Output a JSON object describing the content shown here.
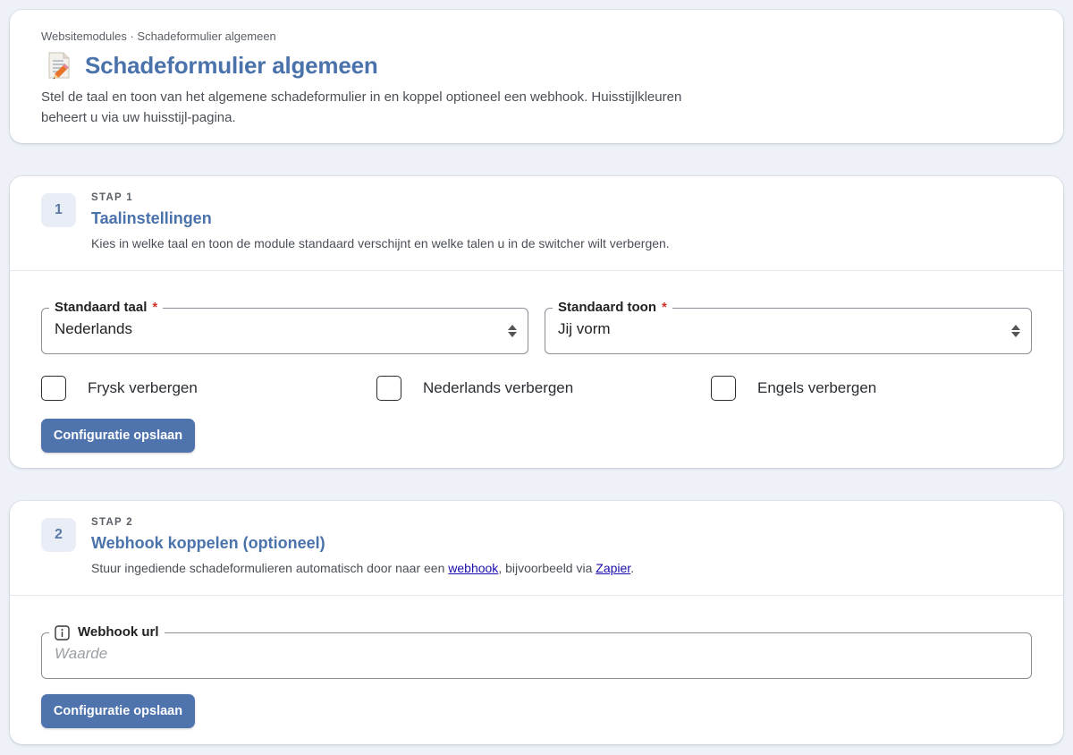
{
  "header": {
    "breadcrumb": "Websitemodules · Schadeformulier algemeen",
    "title": "Schadeformulier algemeen",
    "title_icon": "memo-pencil-icon",
    "description": "Stel de taal en toon van het algemene schadeformulier in en koppel optioneel een webhook. Huisstijlkleuren beheert u via uw huisstijl-pagina."
  },
  "step1": {
    "number": "1",
    "kicker": "STAP 1",
    "title": "Taalinstellingen",
    "description": "Kies in welke taal en toon de module standaard verschijnt en welke talen u in de switcher wilt verbergen.",
    "language_field": {
      "label": "Standaard taal",
      "required_mark": "*",
      "value": "Nederlands"
    },
    "tone_field": {
      "label": "Standaard toon",
      "required_mark": "*",
      "value": "Jij vorm"
    },
    "checkboxes": [
      {
        "label": "Frysk verbergen",
        "checked": false
      },
      {
        "label": "Nederlands verbergen",
        "checked": false
      },
      {
        "label": "Engels verbergen",
        "checked": false
      }
    ],
    "save_label": "Configuratie opslaan"
  },
  "step2": {
    "number": "2",
    "kicker": "STAP 2",
    "title": "Webhook koppelen (optioneel)",
    "description_before": "Stuur ingediende schadeformulieren automatisch door naar een ",
    "link_webhook": "webhook",
    "description_middle": ", bijvoorbeeld via ",
    "link_zapier": "Zapier",
    "description_after": ".",
    "webhook_field": {
      "label": "Webhook url",
      "value": "",
      "placeholder": "Waarde",
      "icon": "info-icon"
    },
    "save_label": "Configuratie opslaan"
  },
  "colors": {
    "accent": "#4a72ab",
    "button": "#4f73ad",
    "background": "#eef2f8",
    "required": "#d0342c",
    "link": "#1a0dab"
  }
}
